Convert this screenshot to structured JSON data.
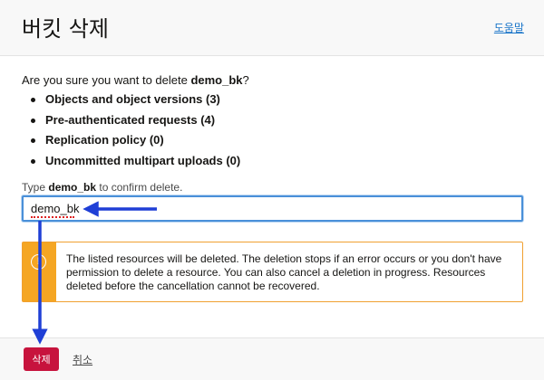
{
  "header": {
    "title": "버킷 삭제",
    "help_label": "도움말"
  },
  "dialog": {
    "question_prefix": "Are you sure you want to delete ",
    "bucket_name": "demo_bk",
    "question_suffix": "?",
    "resources": [
      "Objects and object versions (3)",
      "Pre-authenticated requests (4)",
      "Replication policy (0)",
      "Uncommitted multipart uploads (0)"
    ],
    "confirm_prefix": "Type ",
    "confirm_name": "demo_bk",
    "confirm_suffix": " to confirm delete.",
    "confirm_value": "demo_bk",
    "warning_icon_glyph": "!",
    "warning_text": "The listed resources will be deleted. The deletion stops if an error occurs or you don't have permission to delete a resource. You can also cancel a deletion in progress. Resources deleted before the cancellation cannot be recovered."
  },
  "footer": {
    "delete_label": "삭제",
    "cancel_label": "취소"
  },
  "colors": {
    "accent_blue": "#1a75c9",
    "delete_red": "#c7133d",
    "warning_orange": "#f5a623",
    "annotation_blue": "#1f3fd6"
  },
  "icons": {
    "warning": "warning-icon",
    "annotation_arrows": "arrow-icon"
  }
}
